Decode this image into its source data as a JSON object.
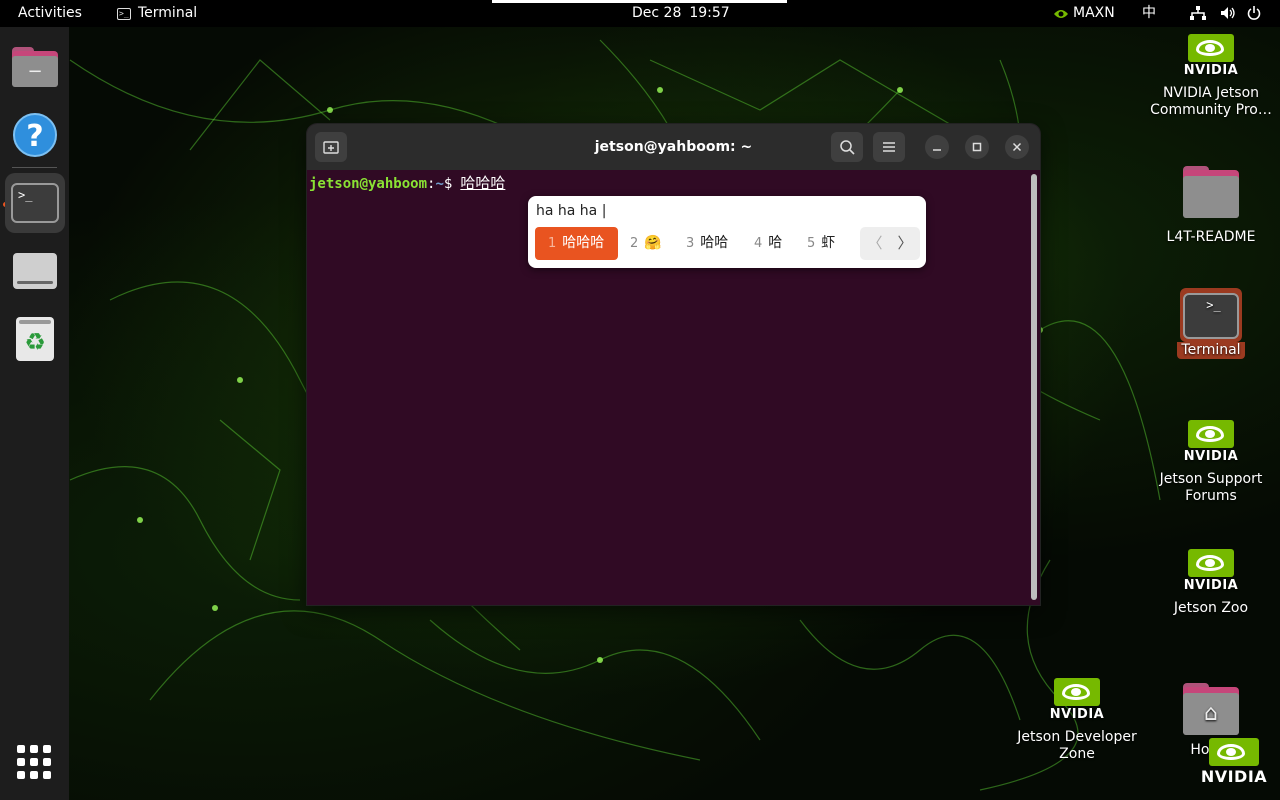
{
  "topbar": {
    "activities": "Activities",
    "app_name": "Terminal",
    "date": "Dec 28",
    "time": "19:57",
    "power_mode": "MAXN",
    "input_method": "中"
  },
  "dock": {
    "items": [
      "files",
      "help",
      "terminal",
      "disk",
      "trash"
    ]
  },
  "desktop": {
    "icons": [
      {
        "label": "NVIDIA Jetson Community Pro…",
        "icon": "nvidia-logo"
      },
      {
        "label": "L4T-README",
        "icon": "folder"
      },
      {
        "label": "Terminal",
        "icon": "terminal"
      },
      {
        "label": "Jetson Support Forums",
        "icon": "nvidia-logo"
      },
      {
        "label": "Jetson Zoo",
        "icon": "nvidia-logo"
      },
      {
        "label": "Jetson Developer Zone",
        "icon": "nvidia-logo"
      },
      {
        "label": "Home",
        "icon": "home-folder"
      }
    ],
    "nvidia_word": "NVIDIA",
    "brand_color": "#76b900"
  },
  "terminal": {
    "title": "jetson@yahboom: ~",
    "prompt_user": "jetson@yahboom",
    "prompt_colon": ":",
    "prompt_path": "~",
    "prompt_dollar": "$",
    "input": "哈哈哈",
    "background_color": "#300a24"
  },
  "ime": {
    "preedit": "ha ha ha |",
    "candidates": [
      {
        "num": "1",
        "text": "哈哈哈",
        "selected": true
      },
      {
        "num": "2",
        "text": "🤗",
        "selected": false
      },
      {
        "num": "3",
        "text": "哈哈",
        "selected": false
      },
      {
        "num": "4",
        "text": "哈",
        "selected": false
      },
      {
        "num": "5",
        "text": "虾",
        "selected": false
      }
    ],
    "prev": "〈",
    "next": "〉",
    "accent_color": "#e95420"
  }
}
